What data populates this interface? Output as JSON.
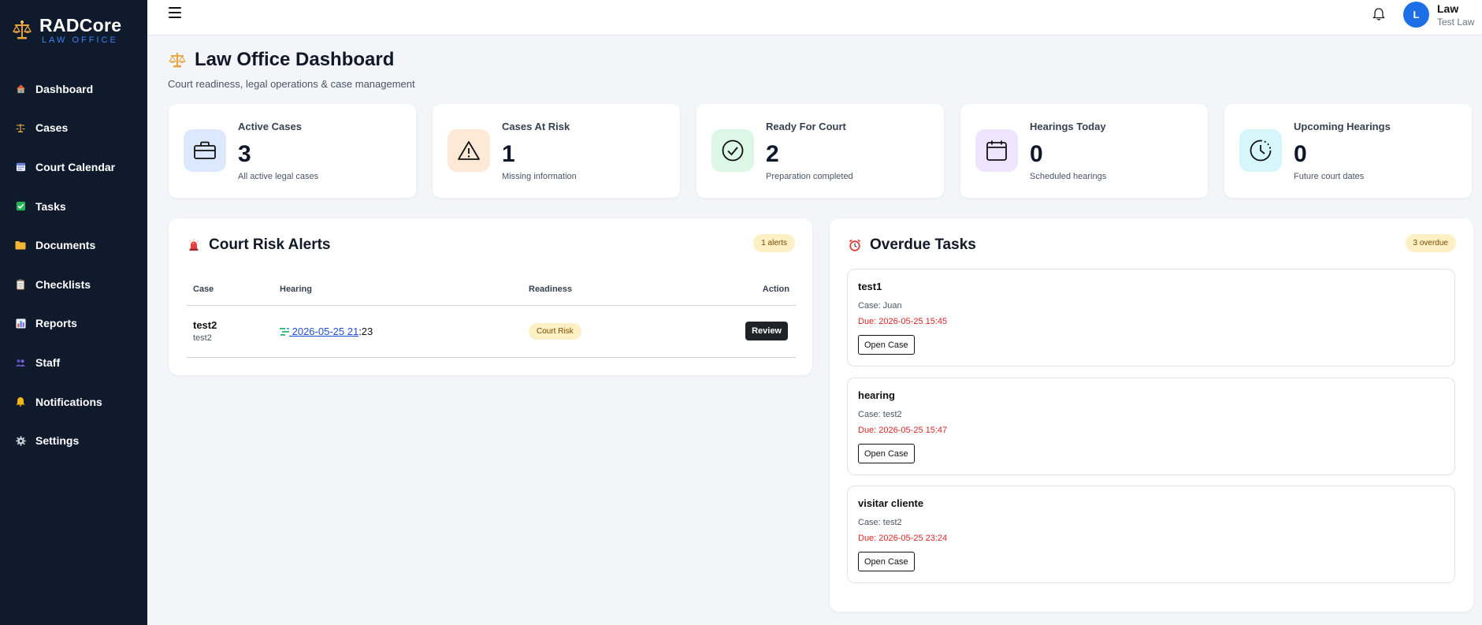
{
  "brand": {
    "name": "RADCore",
    "subtitle": "LAW OFFICE"
  },
  "sidebar": {
    "items": [
      {
        "label": "Dashboard",
        "icon": "home-icon"
      },
      {
        "label": "Cases",
        "icon": "scales-icon"
      },
      {
        "label": "Court Calendar",
        "icon": "calendar-icon"
      },
      {
        "label": "Tasks",
        "icon": "checkbox-icon"
      },
      {
        "label": "Documents",
        "icon": "folder-icon"
      },
      {
        "label": "Checklists",
        "icon": "clipboard-icon"
      },
      {
        "label": "Reports",
        "icon": "bar-chart-icon"
      },
      {
        "label": "Staff",
        "icon": "people-icon"
      },
      {
        "label": "Notifications",
        "icon": "bell-icon"
      },
      {
        "label": "Settings",
        "icon": "gear-icon"
      }
    ]
  },
  "topbar": {
    "avatar_initial": "L",
    "user_name": "Law",
    "user_role": "Test Law"
  },
  "header": {
    "title": "Law Office Dashboard",
    "subtitle": "Court readiness, legal operations & case management"
  },
  "stats": [
    {
      "label": "Active Cases",
      "value": "3",
      "hint": "All active legal cases",
      "icon": "briefcase-icon",
      "bg": "#dbe8fd"
    },
    {
      "label": "Cases At Risk",
      "value": "1",
      "hint": "Missing information",
      "icon": "warning-icon",
      "bg": "#fde9d6"
    },
    {
      "label": "Ready For Court",
      "value": "2",
      "hint": "Preparation completed",
      "icon": "check-circle-icon",
      "bg": "#dcf7e6"
    },
    {
      "label": "Hearings Today",
      "value": "0",
      "hint": "Scheduled hearings",
      "icon": "calendar-icon",
      "bg": "#efe4fd"
    },
    {
      "label": "Upcoming Hearings",
      "value": "0",
      "hint": "Future court dates",
      "icon": "clock-icon",
      "bg": "#d7f6fb"
    }
  ],
  "risk_panel": {
    "title": "Court Risk Alerts",
    "badge": "1 alerts",
    "columns": [
      "Case",
      "Hearing",
      "Readiness",
      "Action"
    ],
    "rows": [
      {
        "case": "test2",
        "case_sub": "test2",
        "hearing_link": " 2026-05-25 21",
        "hearing_rest": ":23",
        "readiness": "Court Risk",
        "action": "Review"
      }
    ]
  },
  "tasks_panel": {
    "title": "Overdue Tasks",
    "badge": "3 overdue",
    "tasks": [
      {
        "name": "test1",
        "case": "Case: Juan",
        "due": "Due: 2026-05-25 15:45",
        "button": "Open Case"
      },
      {
        "name": "hearing",
        "case": "Case: test2",
        "due": "Due: 2026-05-25 15:47",
        "button": "Open Case"
      },
      {
        "name": "visitar cliente",
        "case": "Case: test2",
        "due": "Due: 2026-05-25 23:24",
        "button": "Open Case"
      }
    ]
  }
}
